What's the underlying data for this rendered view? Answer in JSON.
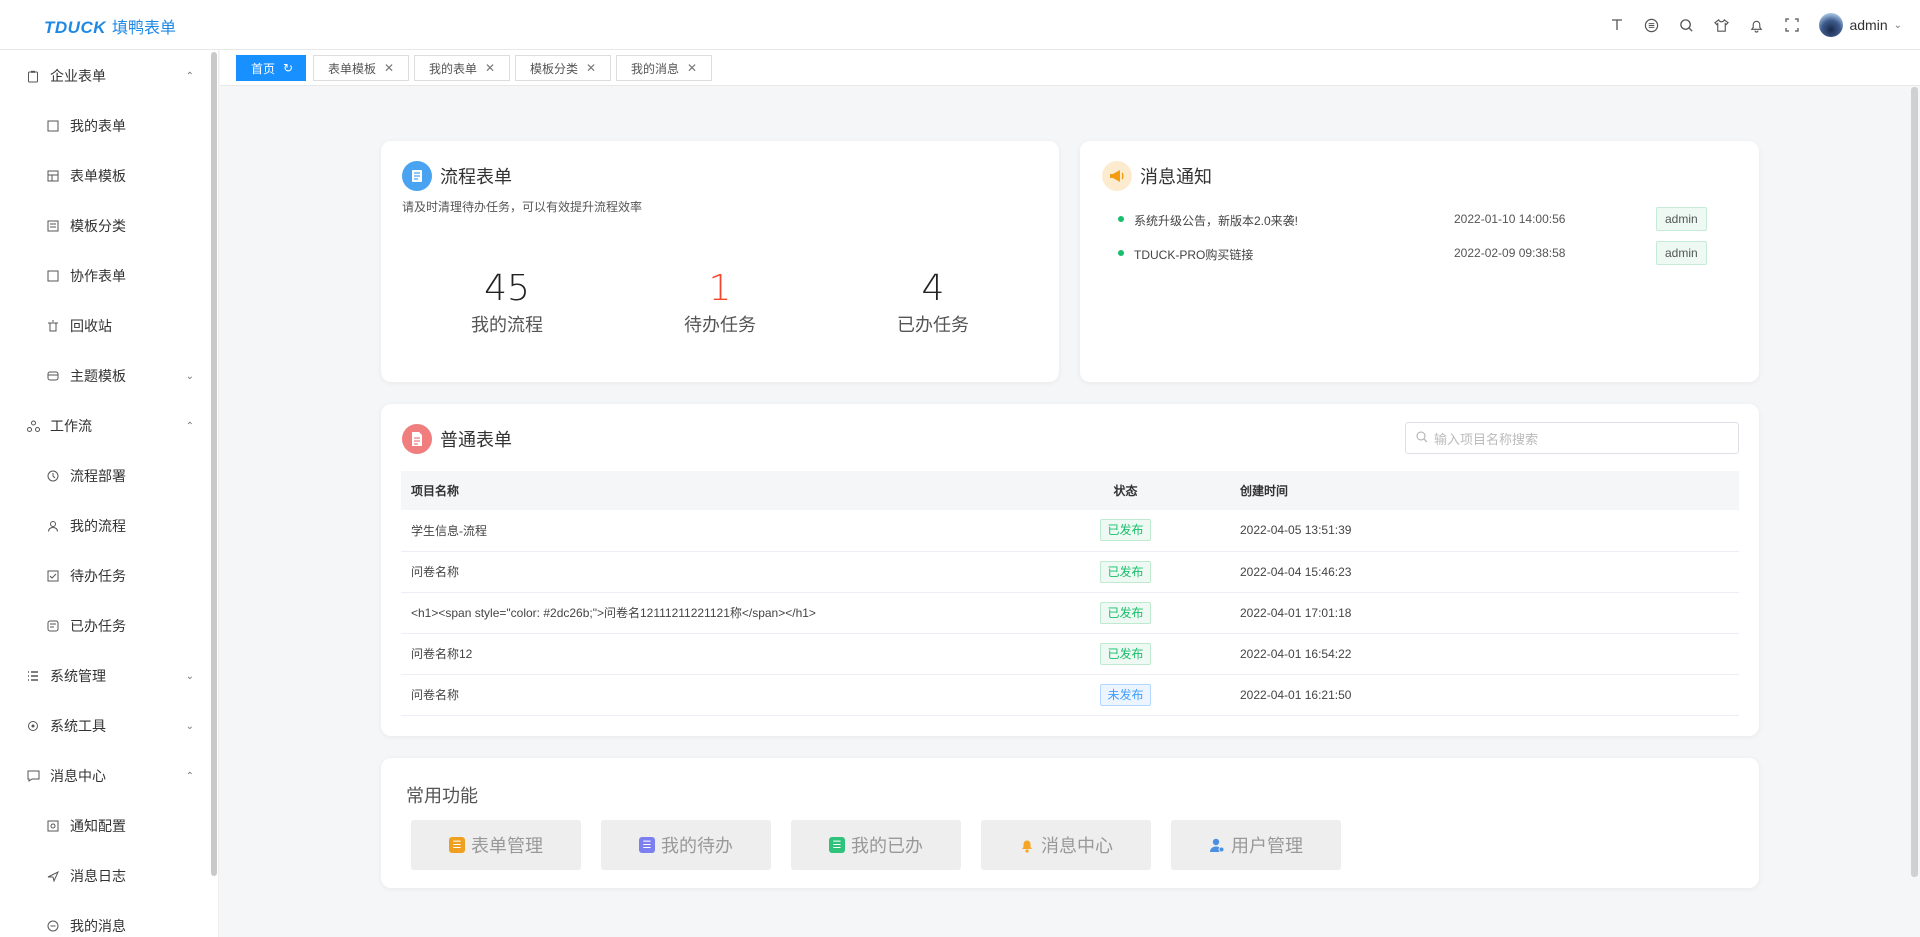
{
  "app": {
    "logo_main": "TDUCK",
    "logo_sub": "填鸭表单"
  },
  "header": {
    "icons": [
      "font-size-icon",
      "github-icon",
      "search-icon",
      "theme-icon",
      "bell-icon",
      "fullscreen-icon"
    ],
    "user_name": "admin"
  },
  "sidebar": {
    "items": [
      {
        "label": "企业表单",
        "level": 1,
        "icon": "clipboard-icon",
        "caret": "up"
      },
      {
        "label": "我的表单",
        "level": 2,
        "icon": "form-icon"
      },
      {
        "label": "表单模板",
        "level": 2,
        "icon": "template-icon"
      },
      {
        "label": "模板分类",
        "level": 2,
        "icon": "category-icon"
      },
      {
        "label": "协作表单",
        "level": 2,
        "icon": "collab-icon"
      },
      {
        "label": "回收站",
        "level": 2,
        "icon": "trash-icon"
      },
      {
        "label": "主题模板",
        "level": 2,
        "icon": "theme-icon",
        "caret": "down"
      },
      {
        "label": "工作流",
        "level": 1,
        "icon": "workflow-icon",
        "caret": "up"
      },
      {
        "label": "流程部署",
        "level": 2,
        "icon": "deploy-icon"
      },
      {
        "label": "我的流程",
        "level": 2,
        "icon": "user-icon"
      },
      {
        "label": "待办任务",
        "level": 2,
        "icon": "todo-icon"
      },
      {
        "label": "已办任务",
        "level": 2,
        "icon": "done-icon"
      },
      {
        "label": "系统管理",
        "level": 1,
        "icon": "list-icon",
        "caret": "down"
      },
      {
        "label": "系统工具",
        "level": 1,
        "icon": "tool-icon",
        "caret": "down"
      },
      {
        "label": "消息中心",
        "level": 1,
        "icon": "message-icon",
        "caret": "up"
      },
      {
        "label": "通知配置",
        "level": 2,
        "icon": "config-icon"
      },
      {
        "label": "消息日志",
        "level": 2,
        "icon": "send-icon"
      },
      {
        "label": "我的消息",
        "level": 2,
        "icon": "chat-icon"
      }
    ]
  },
  "tabs": [
    {
      "label": "首页",
      "active": true,
      "close": "↻"
    },
    {
      "label": "表单模板",
      "active": false,
      "close": "✕"
    },
    {
      "label": "我的表单",
      "active": false,
      "close": "✕"
    },
    {
      "label": "模板分类",
      "active": false,
      "close": "✕"
    },
    {
      "label": "我的消息",
      "active": false,
      "close": "✕"
    }
  ],
  "flow_card": {
    "title": "流程表单",
    "subtitle": "请及时清理待办任务，可以有效提升流程效率",
    "stats": [
      {
        "value": "45",
        "label": "我的流程",
        "color": "#222222"
      },
      {
        "value": "1",
        "label": "待办任务",
        "color": "#f5462d"
      },
      {
        "value": "4",
        "label": "已办任务",
        "color": "#222222"
      }
    ]
  },
  "notice_card": {
    "title": "消息通知",
    "items": [
      {
        "text": "系统升级公告，新版本2.0来袭!",
        "time": "2022-01-10 14:00:56",
        "author": "admin"
      },
      {
        "text": "TDUCK-PRO购买链接",
        "time": "2022-02-09 09:38:58",
        "author": "admin"
      }
    ]
  },
  "forms_card": {
    "title": "普通表单",
    "search_placeholder": "输入项目名称搜索",
    "columns": [
      "项目名称",
      "状态",
      "创建时间"
    ],
    "rows": [
      {
        "name": "学生信息-流程",
        "status": "已发布",
        "published": true,
        "created": "2022-04-05 13:51:39"
      },
      {
        "name": "问卷名称",
        "status": "已发布",
        "published": true,
        "created": "2022-04-04 15:46:23"
      },
      {
        "name": "<h1><span style=\"color: #2dc26b;\">问卷名12111211221121称</span></h1>",
        "status": "已发布",
        "published": true,
        "created": "2022-04-01 17:01:18"
      },
      {
        "name": "问卷名称12",
        "status": "已发布",
        "published": true,
        "created": "2022-04-01 16:54:22"
      },
      {
        "name": "问卷名称",
        "status": "未发布",
        "published": false,
        "created": "2022-04-01 16:21:50"
      }
    ]
  },
  "func_card": {
    "title": "常用功能",
    "buttons": [
      {
        "label": "表单管理",
        "icon": "form-manage-icon",
        "color": "#f0a020"
      },
      {
        "label": "我的待办",
        "icon": "todo-icon",
        "color": "#7b7ff0"
      },
      {
        "label": "我的已办",
        "icon": "done-icon",
        "color": "#2fc27a"
      },
      {
        "label": "消息中心",
        "icon": "bell-icon",
        "color": "#f5a623"
      },
      {
        "label": "用户管理",
        "icon": "user-manage-icon",
        "color": "#4a90e2"
      }
    ]
  },
  "colors": {
    "primary": "#1890ff",
    "logo": "#1e88e5",
    "success": "#19be6b",
    "danger": "#f5462d"
  }
}
